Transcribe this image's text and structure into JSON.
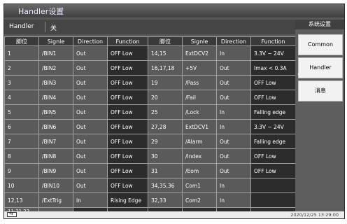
{
  "window": {
    "title": "Handler设置"
  },
  "header": {
    "label": "Handler",
    "value": "关"
  },
  "table": {
    "columns": [
      "脚位",
      "Signle",
      "Direction",
      "Function",
      "脚位",
      "Signle",
      "Direction",
      "Function"
    ],
    "rows": [
      [
        "1",
        "/BIN1",
        "Out",
        "OFF Low",
        "14,15",
        "ExtDCV2",
        "In",
        "3.3V ~ 24V"
      ],
      [
        "2",
        "/BIN2",
        "Out",
        "OFF Low",
        "16,17,18",
        "+5V",
        "Out",
        "Imax < 0.3A"
      ],
      [
        "3",
        "/BIN3",
        "Out",
        "OFF Low",
        "19",
        "/Pass",
        "Out",
        "OFF Low"
      ],
      [
        "4",
        "/BIN4",
        "Out",
        "OFF Low",
        "20",
        "/Fail",
        "Out",
        "OFF Low"
      ],
      [
        "5",
        "/BIN5",
        "Out",
        "OFF Low",
        "25",
        "/Lock",
        "In",
        "Falling edge"
      ],
      [
        "6",
        "/BIN6",
        "Out",
        "OFF Low",
        "27,28",
        "ExtDCV1",
        "In",
        "3.3V ~ 24V"
      ],
      [
        "7",
        "/BIN7",
        "Out",
        "OFF Low",
        "29",
        "/Alarm",
        "Out",
        "Falling edge"
      ],
      [
        "8",
        "/BIN8",
        "Out",
        "OFF Low",
        "30",
        "/Index",
        "Out",
        "OFF Low"
      ],
      [
        "9",
        "/BIN9",
        "Out",
        "OFF Low",
        "31",
        "/Eom",
        "Out",
        "OFF Low"
      ],
      [
        "10",
        "/BIN10",
        "Out",
        "OFF Low",
        "34,35,36",
        "Com1",
        "In",
        ""
      ],
      [
        "12,13",
        "/ExtTrig",
        "In",
        "Rising Edge",
        "32,33",
        "Com2",
        "In",
        ""
      ],
      [
        "11,21,22, 23,24,26,",
        "Reserve",
        "",
        "",
        "",
        "",
        "",
        ""
      ]
    ]
  },
  "side_panel": {
    "title": "系统设置",
    "buttons": [
      "Common",
      "Handler",
      "消息"
    ],
    "selected_marker": "›"
  },
  "status_bar": {
    "datetime": "2020/12/25 13:29:00",
    "usb_icon": "usb-icon"
  }
}
